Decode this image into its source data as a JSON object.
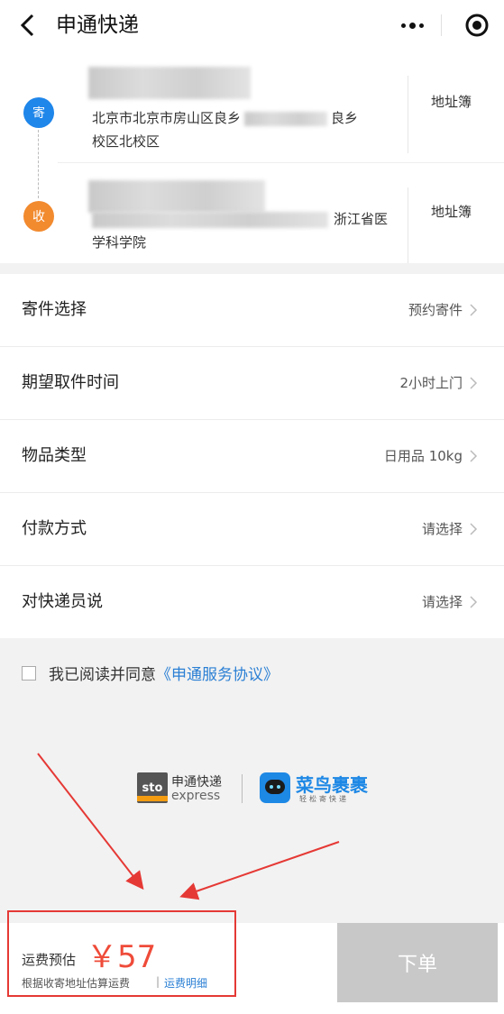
{
  "header": {
    "title": "申通快递",
    "back_icon": "chevron-left-icon",
    "more_icon": "more-dots-icon",
    "close_icon": "target-circle-icon"
  },
  "sender": {
    "badge": "寄",
    "address": "北京市北京市房山区良乡 良乡校区北校区",
    "address_line1": "北京市北京市房山区良乡",
    "address_line1_end": "良乡",
    "address_line2": "校区北校区",
    "book_label": "地址簿"
  },
  "receiver": {
    "badge": "收",
    "address_line1_end": "浙江省医",
    "address_line2": "学科学院",
    "book_label": "地址簿"
  },
  "options": [
    {
      "label": "寄件选择",
      "value": "预约寄件"
    },
    {
      "label": "期望取件时间",
      "value": "2小时上门"
    },
    {
      "label": "物品类型",
      "value": "日用品 10kg"
    },
    {
      "label": "付款方式",
      "value": "请选择"
    },
    {
      "label": "对快递员说",
      "value": "请选择"
    }
  ],
  "agreement": {
    "text": "我已阅读并同意",
    "link": "《申通服务协议》"
  },
  "logos": {
    "sto_mark": "sto",
    "sto_name": "申通快递",
    "sto_sub": "express",
    "cainiao_name": "菜鸟裹裹",
    "cainiao_sub": "轻松寄快递"
  },
  "footer": {
    "fee_label": "运费预估",
    "price": "￥57",
    "note": "根据收寄地址估算运费",
    "sep": "|",
    "detail_link": "运费明细",
    "order_button": "下单"
  },
  "colors": {
    "accent_blue": "#1f86ea",
    "accent_orange": "#f28a2e",
    "price_red": "#ef4b39",
    "link_blue": "#2a7fd4",
    "annotation_red": "#e53935"
  }
}
